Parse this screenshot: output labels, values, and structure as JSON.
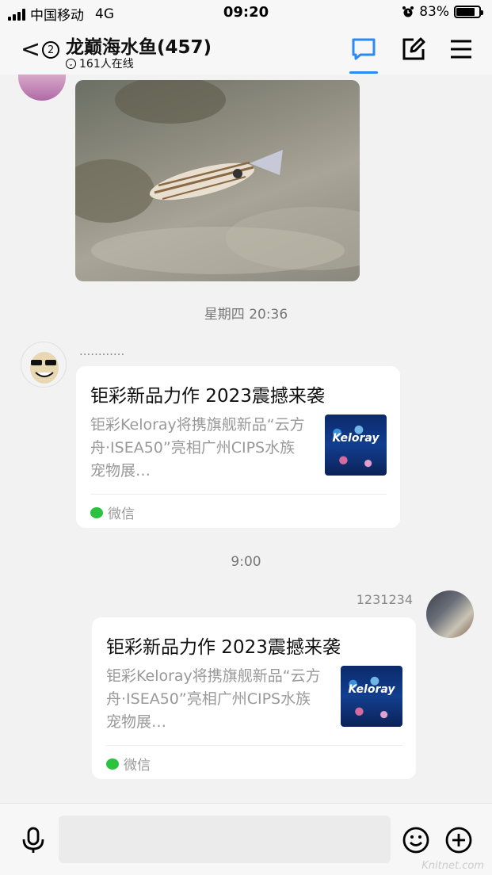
{
  "status_bar": {
    "carrier": "中国移动",
    "network": "4G",
    "time": "09:20",
    "battery": "83%",
    "battery_level": 0.83
  },
  "header": {
    "back_badge": "2",
    "title": "龙巅海水鱼(457)",
    "online": "161人在线",
    "icons": [
      "chat-icon",
      "edit-icon",
      "menu-icon"
    ]
  },
  "messages": {
    "photo_alt": "fish photo",
    "time_1": "星期四 20:36",
    "sender_1": "............",
    "card_1": {
      "title": "钜彩新品力作 2023震撼来袭",
      "desc": "钜彩Keloray将携旗舰新品“云方舟·ISEA50”亮相广州CIPS水族宠物展…",
      "thumb_text": "Keloray",
      "source": "微信"
    },
    "time_2": "9:00",
    "sender_2": "1231234",
    "card_2": {
      "title": "钜彩新品力作 2023震撼来袭",
      "desc": "钜彩Keloray将携旗舰新品“云方舟·ISEA50”亮相广州CIPS水族宠物展…",
      "thumb_text": "Keloray",
      "source": "微信"
    }
  },
  "bottom_bar": {
    "icons": [
      "microphone-icon",
      "emoji-icon",
      "add-icon"
    ],
    "watermark": "Knitnet.com"
  },
  "colors": {
    "accent": "#2a8af2",
    "background": "#f2f2f2",
    "wechat_green": "#2bc240"
  }
}
